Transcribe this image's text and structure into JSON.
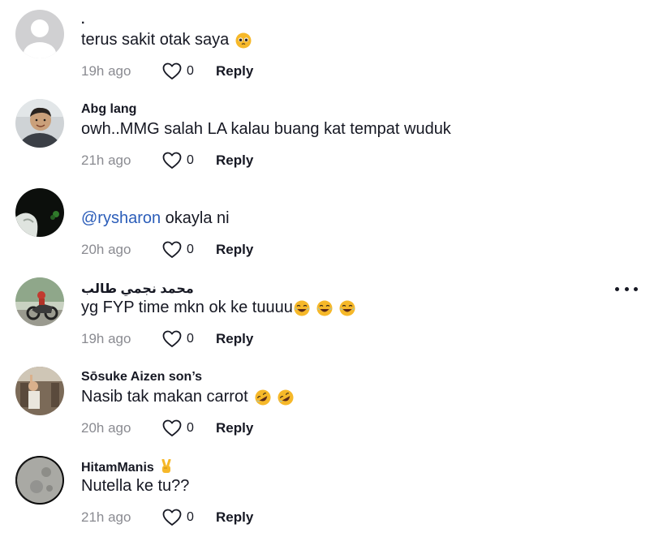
{
  "comments": [
    {
      "username": ".",
      "text": "terus sakit otak saya",
      "mention": "",
      "emojis": [
        "pleading-face"
      ],
      "time": "19h ago",
      "likes": "0",
      "reply_label": "Reply",
      "avatar": "default-gray"
    },
    {
      "username": "Abg lang",
      "text": "owh..MMG salah LA kalau buang kat tempat wuduk",
      "mention": "",
      "emojis": [],
      "time": "21h ago",
      "likes": "0",
      "reply_label": "Reply",
      "avatar": "child-photo"
    },
    {
      "username": "",
      "text": " okayla ni",
      "mention": "@rysharon",
      "emojis": [],
      "time": "20h ago",
      "likes": "0",
      "reply_label": "Reply",
      "avatar": "dark-photo"
    },
    {
      "username": "محمد نجمي طالب",
      "text": "yg FYP time mkn ok ke tuuuu",
      "mention": "",
      "emojis": [
        "laughing-face",
        "laughing-face",
        "laughing-face"
      ],
      "time": "19h ago",
      "likes": "0",
      "reply_label": "Reply",
      "avatar": "motorcycle-photo"
    },
    {
      "username": "Sōsuke Aizen son’s",
      "text": "Nasib tak makan carrot",
      "mention": "",
      "emojis": [
        "rofl-face",
        "rofl-face"
      ],
      "time": "20h ago",
      "likes": "0",
      "reply_label": "Reply",
      "avatar": "person-photo"
    },
    {
      "username": "HitamManis",
      "text": "Nutella ke tu??",
      "mention": "",
      "emojis": [],
      "username_emoji": "victory-hand",
      "time": "21h ago",
      "likes": "0",
      "reply_label": "Reply",
      "avatar": "moon-photo"
    }
  ],
  "icons": {
    "like": "heart-outline-icon",
    "more": "three-dots-icon"
  },
  "colors": {
    "text": "#161823",
    "muted": "#8a8b91",
    "mention": "#2b5db9",
    "emoji": "#f6b829"
  }
}
